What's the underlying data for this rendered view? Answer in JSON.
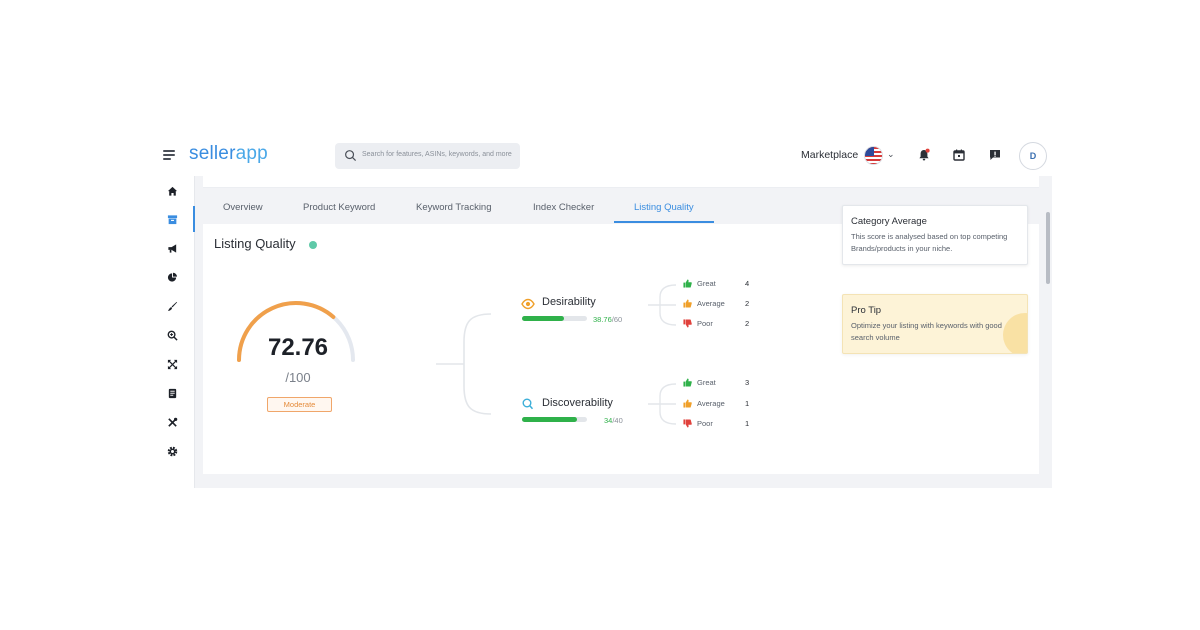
{
  "app": {
    "logo_part1": "seller",
    "logo_part2": "app"
  },
  "search": {
    "placeholder": "Search for features, ASINs, keywords, and more"
  },
  "header": {
    "marketplace_label": "Marketplace",
    "marketplace_flag": "us-flag-icon",
    "avatar_initial": "D",
    "icons": [
      "bell-icon",
      "calendar-icon",
      "feedback-icon"
    ]
  },
  "sidebar": {
    "items": [
      {
        "icon": "home-icon"
      },
      {
        "icon": "product-box-icon",
        "active": true
      },
      {
        "icon": "megaphone-icon"
      },
      {
        "icon": "pie-chart-icon"
      },
      {
        "icon": "brush-icon"
      },
      {
        "icon": "zoom-search-icon"
      },
      {
        "icon": "expand-icon"
      },
      {
        "icon": "document-icon"
      },
      {
        "icon": "tools-icon"
      },
      {
        "icon": "settings-icon"
      }
    ]
  },
  "tabs": [
    {
      "label": "Overview"
    },
    {
      "label": "Product Keyword"
    },
    {
      "label": "Keyword Tracking"
    },
    {
      "label": "Index Checker"
    },
    {
      "label": "Listing Quality",
      "active": true
    }
  ],
  "panel": {
    "title": "Listing Quality",
    "score": "72.76",
    "score_max": "/100",
    "score_fraction": 0.7276,
    "badge": "Moderate"
  },
  "metrics": [
    {
      "name": "Desirability",
      "icon": "eye-icon",
      "value": "38.76",
      "max": "/60",
      "fraction": 0.646,
      "ratings": [
        {
          "label": "Great",
          "count": "4",
          "icon": "thumbs-up-icon",
          "color": "#2fb14a"
        },
        {
          "label": "Average",
          "count": "2",
          "icon": "thumbs-up-icon",
          "color": "#f0a02a"
        },
        {
          "label": "Poor",
          "count": "2",
          "icon": "thumbs-down-icon",
          "color": "#e0413b"
        }
      ]
    },
    {
      "name": "Discoverability",
      "icon": "search-icon",
      "value": "34",
      "max": "/40",
      "fraction": 0.85,
      "ratings": [
        {
          "label": "Great",
          "count": "3",
          "icon": "thumbs-up-icon",
          "color": "#2fb14a"
        },
        {
          "label": "Average",
          "count": "1",
          "icon": "thumbs-up-icon",
          "color": "#f0a02a"
        },
        {
          "label": "Poor",
          "count": "1",
          "icon": "thumbs-down-icon",
          "color": "#e0413b"
        }
      ]
    }
  ],
  "category_average": {
    "title": "Category Average",
    "text": "This score is analysed based on top competing Brands/products in your niche."
  },
  "pro_tip": {
    "title": "Pro Tip",
    "text": "Optimize your listing with keywords with good search volume"
  },
  "colors": {
    "accent": "#3a8de0",
    "gauge": "#f0a04b",
    "bar": "#2fb14a"
  }
}
